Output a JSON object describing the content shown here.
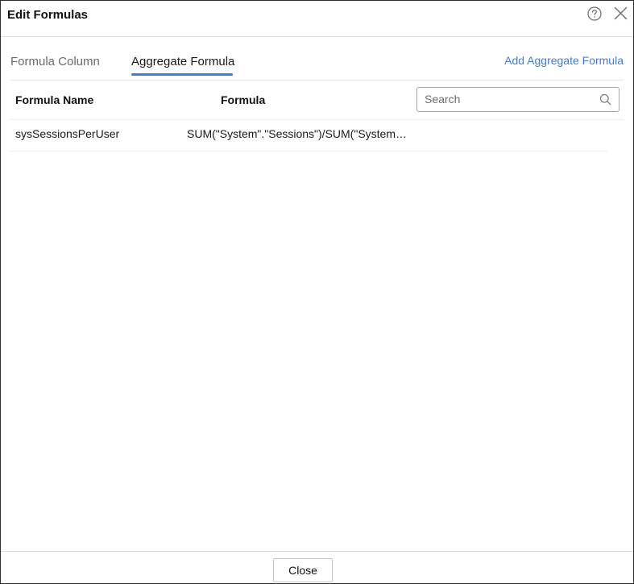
{
  "dialog": {
    "title": "Edit Formulas",
    "help_icon": "help-circle-icon",
    "close_icon": "close-icon"
  },
  "tabs": [
    {
      "label": "Formula Column",
      "active": false
    },
    {
      "label": "Aggregate Formula",
      "active": true
    }
  ],
  "add_link": "Add Aggregate Formula",
  "table": {
    "columns": [
      "Formula Name",
      "Formula"
    ],
    "rows": [
      {
        "name": "sysSessionsPerUser",
        "formula": "SUM(\"System\".\"Sessions\")/SUM(\"System\".\"Users\")"
      }
    ]
  },
  "search": {
    "placeholder": "Search",
    "value": ""
  },
  "footer": {
    "close_label": "Close"
  },
  "colors": {
    "accent": "#3d7be0",
    "link": "#3a7fdc",
    "border": "#2e2e2e"
  }
}
